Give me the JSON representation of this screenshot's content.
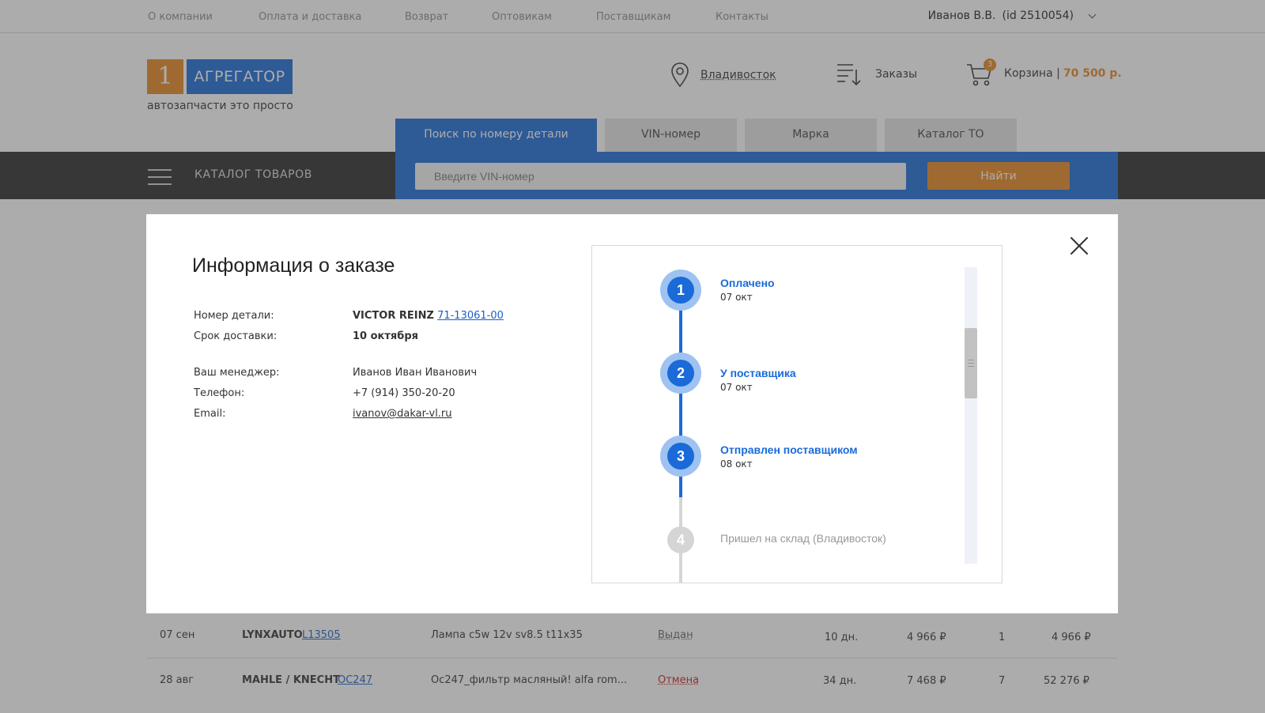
{
  "topnav": [
    "О компании",
    "Оплата и доставка",
    "Возврат",
    "Оптовикам",
    "Поставщикам",
    "Контакты"
  ],
  "user": {
    "name": "Иванов В.В.",
    "id": "(id 2510054)"
  },
  "logo": {
    "number": "1",
    "word": "АГРЕГАТОР",
    "tagline": "автозапчасти это просто"
  },
  "header": {
    "city": "Владивосток",
    "orders": "Заказы",
    "cart_label": "Корзина |",
    "cart_total": "70 500 р.",
    "cart_count": "3"
  },
  "search": {
    "tabs": [
      "Поиск по номеру детали",
      "VIN-номер",
      "Марка",
      "Каталог ТО"
    ],
    "placeholder": "Введите VIN-номер",
    "button": "Найти",
    "catalog": "КАТАЛОГ ТОВАРОВ"
  },
  "colors": {
    "brand_blue": "#1a6ad8",
    "brand_orange": "#e7871f",
    "dark_bar": "#2b2b2b"
  },
  "modal": {
    "title": "Информация о заказе",
    "part_label": "Номер детали:",
    "part_brand": "VICTOR REINZ",
    "part_number": "71-13061-00",
    "delivery_label": "Срок доставки:",
    "delivery_value": "10 октября",
    "manager_label": "Ваш менеджер:",
    "manager_value": "Иванов Иван Иванович",
    "phone_label": "Телефон:",
    "phone_value": "+7 (914) 350-20-20",
    "email_label": "Email:",
    "email_value": "ivanov@dakar-vl.ru",
    "steps": [
      {
        "num": "1",
        "title": "Оплачено",
        "date": "07 окт",
        "status": "done"
      },
      {
        "num": "2",
        "title": "У поставщика",
        "date": "07 окт",
        "status": "done"
      },
      {
        "num": "3",
        "title": "Отправлен поставщиком",
        "date": "08 окт",
        "status": "done"
      },
      {
        "num": "4",
        "title": "Пришел на склад (Владивосток)",
        "date": "",
        "status": "pending"
      }
    ]
  },
  "orders_table": [
    {
      "date": "07 сен",
      "brand": "LYNXAUTO",
      "article": "L13505",
      "desc": "Лампа с5w 12v sv8.5 t11x35",
      "status": "Выдан",
      "days": "10 дн.",
      "price": "4 966 ₽",
      "qty": "1",
      "sum": "4 966 ₽"
    },
    {
      "date": "28 авг",
      "brand": "MAHLE / KNECHT",
      "article": "OC247",
      "desc": "Oc247_фильтр масляный! alfa rom...",
      "status": "Отмена",
      "days": "34 дн.",
      "price": "7 468 ₽",
      "qty": "7",
      "sum": "52 276 ₽"
    }
  ]
}
